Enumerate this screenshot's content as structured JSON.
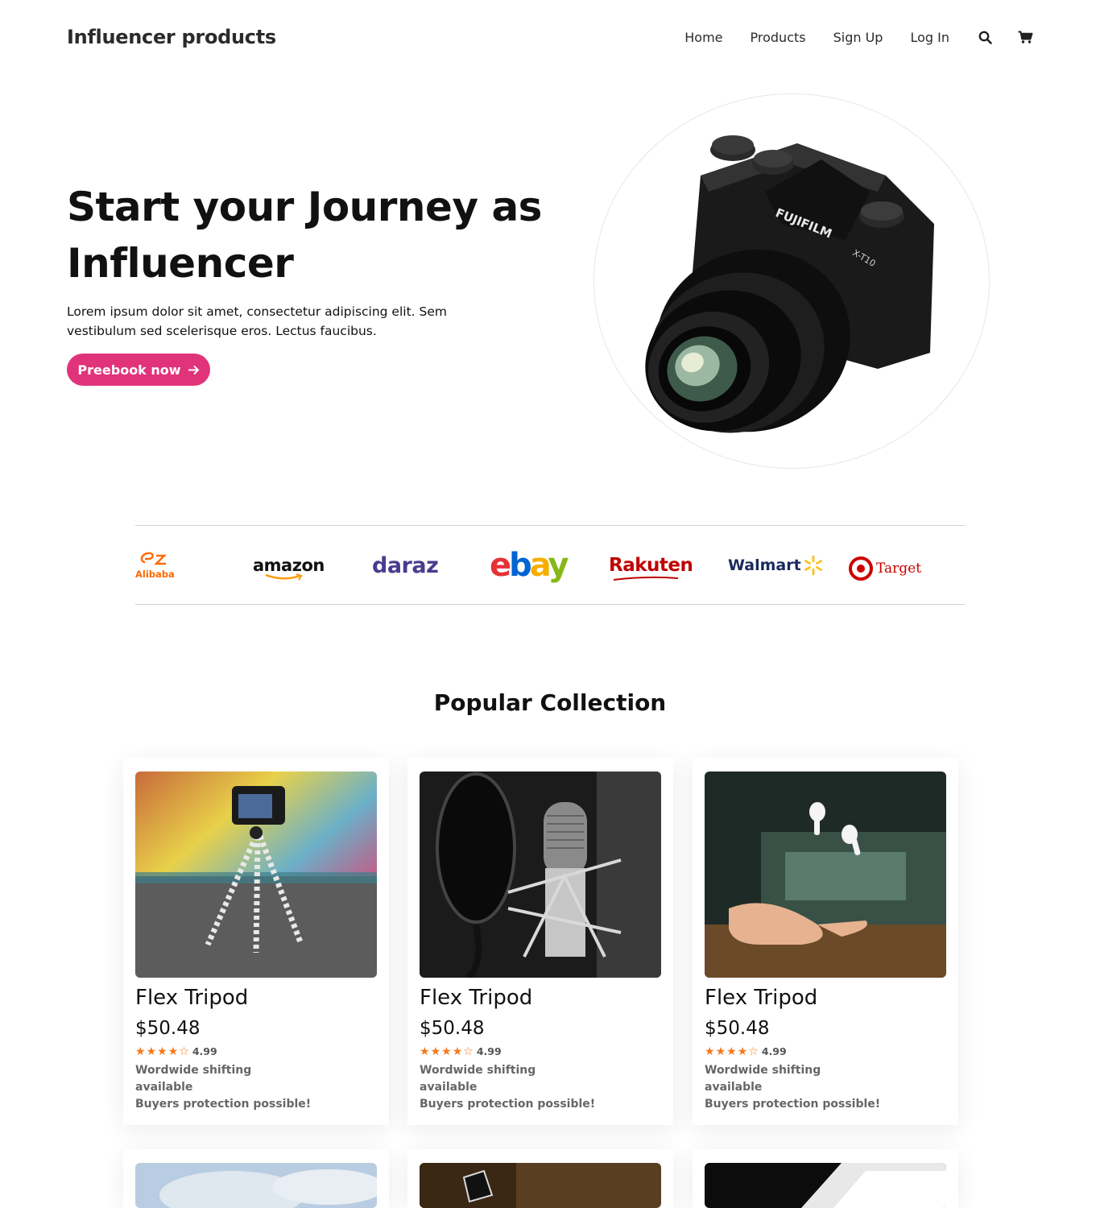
{
  "header": {
    "brand": "Influencer products",
    "nav": [
      "Home",
      "Products",
      "Sign Up",
      "Log In"
    ],
    "icons": [
      "search-icon",
      "cart-icon"
    ]
  },
  "hero": {
    "title": "Start your Journey as Influencer",
    "text": "Lorem ipsum dolor sit amet, consectetur adipiscing elit. Sem vestibulum sed scelerisque eros. Lectus faucibus.",
    "cta_label": "Preebook now",
    "camera_brand": "FUJIFILM",
    "camera_model": "X-T10"
  },
  "partners": {
    "alibaba": "Alibaba",
    "amazon": "amazon",
    "daraz": "daraz",
    "ebay_e": "e",
    "ebay_b": "b",
    "ebay_a": "a",
    "ebay_y": "y",
    "rakuten": "Rakuten",
    "walmart": "Walmart",
    "target": "Target"
  },
  "collection": {
    "title": "Popular Collection",
    "products": [
      {
        "name": "Flex Tripod",
        "price": "$50.48",
        "rating": "4.99",
        "shipping": "Wordwide shifting available",
        "protection": "Buyers protection possible!"
      },
      {
        "name": "Flex Tripod",
        "price": "$50.48",
        "rating": "4.99",
        "shipping": "Wordwide shifting available",
        "protection": "Buyers protection possible!"
      },
      {
        "name": "Flex Tripod",
        "price": "$50.48",
        "rating": "4.99",
        "shipping": "Wordwide shifting available",
        "protection": "Buyers protection possible!"
      }
    ]
  },
  "colors": {
    "accent": "#e0337a",
    "star": "#f7771a",
    "text": "#111111"
  }
}
